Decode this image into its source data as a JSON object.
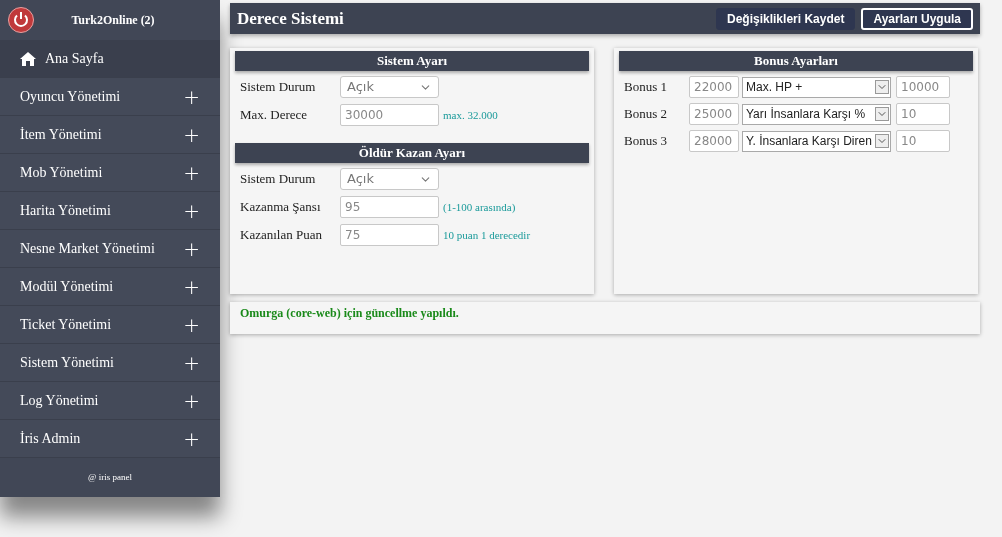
{
  "sidebar": {
    "title": "Turk2Online (2)",
    "items": [
      {
        "label": "Ana Sayfa",
        "kind": "home",
        "selected": true
      },
      {
        "label": "Oyuncu Yönetimi",
        "kind": "group",
        "selected": false
      },
      {
        "label": "İtem Yönetimi",
        "kind": "group",
        "selected": false
      },
      {
        "label": "Mob Yönetimi",
        "kind": "group",
        "selected": false
      },
      {
        "label": "Harita Yönetimi",
        "kind": "group",
        "selected": false
      },
      {
        "label": "Nesne Market Yönetimi",
        "kind": "group",
        "selected": false
      },
      {
        "label": "Modül Yönetimi",
        "kind": "group",
        "selected": false
      },
      {
        "label": "Ticket Yönetimi",
        "kind": "group",
        "selected": false
      },
      {
        "label": "Sistem Yönetimi",
        "kind": "group",
        "selected": false
      },
      {
        "label": "Log Yönetimi",
        "kind": "group",
        "selected": false
      },
      {
        "label": "İris Admin",
        "kind": "group",
        "selected": false
      }
    ],
    "footer": "@ iris panel",
    "expand_symbol": "+"
  },
  "header": {
    "title": "Derece Sistemi",
    "buttons": [
      {
        "label": "Değişiklikleri Kaydet",
        "selected": false
      },
      {
        "label": "Ayarları Uygula",
        "selected": true
      }
    ]
  },
  "panels": [
    {
      "title": "Sistem Ayarı",
      "rows": [
        {
          "label": "Sistem Durum",
          "kind": "select",
          "value": "Açık"
        },
        {
          "label": "Max. Derece",
          "kind": "input",
          "value": "30000",
          "hint": "max. 32.000"
        }
      ]
    },
    {
      "title": "Öldür Kazan Ayarı",
      "rows": [
        {
          "label": "Sistem Durum",
          "kind": "select",
          "value": "Açık"
        },
        {
          "label": "Kazanma Şansı",
          "kind": "input",
          "value": "95",
          "hint": "(1-100 arasında)"
        },
        {
          "label": "Kazanılan Puan",
          "kind": "input",
          "value": "75",
          "hint": "10 puan 1 derecedir"
        }
      ]
    }
  ],
  "bonus": {
    "title": "Bonus Ayarları",
    "rows": [
      {
        "label": "Bonus 1",
        "points": "22000",
        "type": "Max. HP +",
        "amount": "10000"
      },
      {
        "label": "Bonus 2",
        "points": "25000",
        "type": "Yarı İnsanlara Karşı %",
        "amount": "10"
      },
      {
        "label": "Bonus 3",
        "points": "28000",
        "type": "Y. İnsanlara Karşı Diren",
        "amount": "10"
      }
    ]
  },
  "status_message": "Omurga (core-web) için güncellme yapıldı."
}
